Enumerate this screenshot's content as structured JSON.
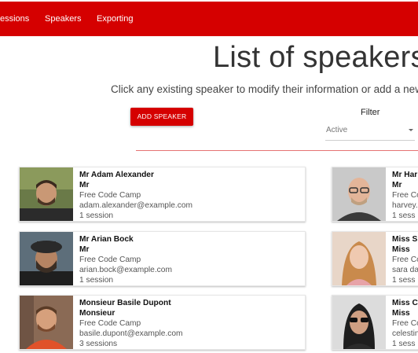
{
  "nav": {
    "items": [
      {
        "label": "essions"
      },
      {
        "label": "Speakers"
      },
      {
        "label": "Exporting"
      }
    ]
  },
  "page": {
    "title": "List of speakers",
    "subtitle": "Click any existing speaker to modify their information or add a new"
  },
  "toolbar": {
    "add_label": "ADD SPEAKER",
    "filter_label": "Filter",
    "filter_value": "Active"
  },
  "colors": {
    "brand": "#d50000",
    "divider": "#e57373"
  },
  "speakers_left": [
    {
      "name": "Mr Adam Alexander",
      "honorific": "Mr",
      "org": "Free Code Camp",
      "email": "adam.alexander@example.com",
      "sessions": "1 session"
    },
    {
      "name": "Mr Arian Bock",
      "honorific": "Mr",
      "org": "Free Code Camp",
      "email": "arian.bock@example.com",
      "sessions": "1 session"
    },
    {
      "name": "Monsieur Basile Dupont",
      "honorific": "Monsieur",
      "org": "Free Code Camp",
      "email": "basile.dupont@example.com",
      "sessions": "3 sessions"
    }
  ],
  "speakers_right": [
    {
      "name": "Mr Har",
      "honorific": "Mr",
      "org": "Free Co",
      "email": "harvey.",
      "sessions": "1 sess"
    },
    {
      "name": "Miss S",
      "honorific": "Miss",
      "org": "Free Co",
      "email": "sara da",
      "sessions": "1 sess"
    },
    {
      "name": "Miss C",
      "honorific": "Miss",
      "org": "Free Co",
      "email": "celestin",
      "sessions": "1 sess"
    }
  ]
}
